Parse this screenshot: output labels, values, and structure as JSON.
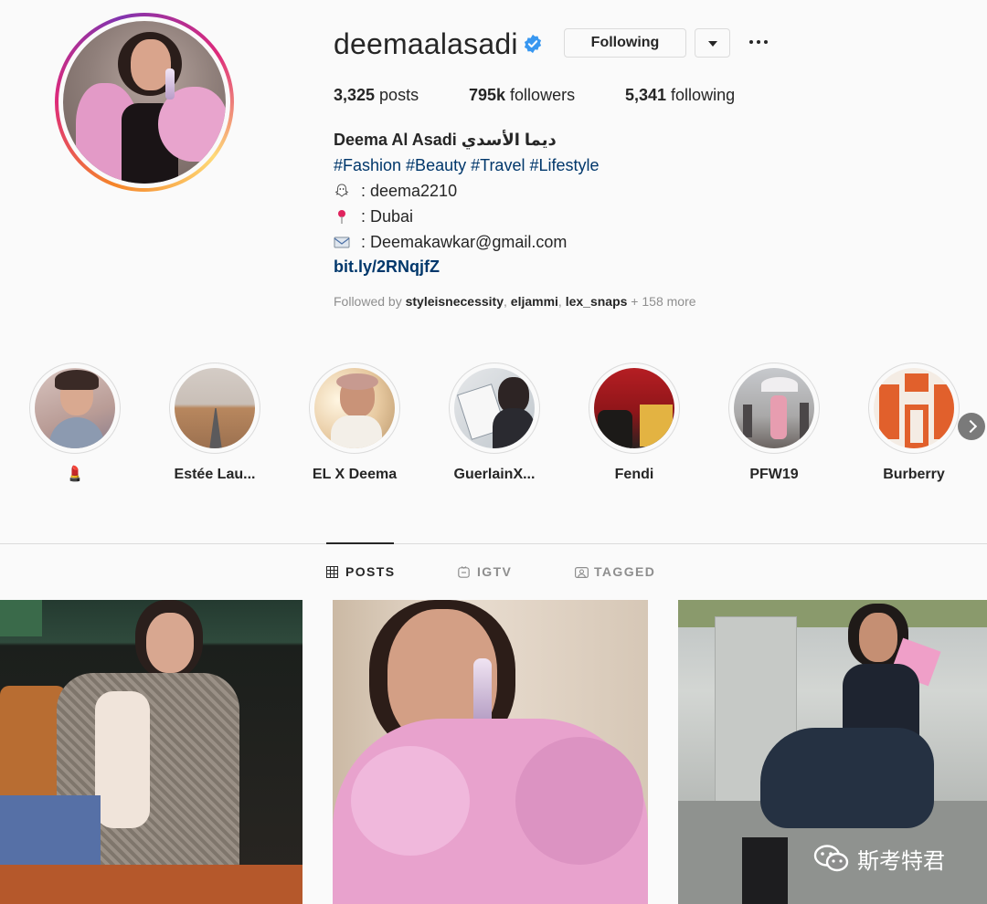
{
  "profile": {
    "username": "deemaalasadi",
    "following_button": "Following",
    "posts_count": "3,325",
    "posts_label": " posts",
    "followers_count": "795k",
    "followers_label": " followers",
    "following_count": "5,341",
    "following_label": " following",
    "full_name": "Deema Al Asadi ديما الأسدي",
    "hashtags": "#Fashion #Beauty #Travel #Lifestyle",
    "bio_lines": [
      {
        "icon": "snapchat-ghost-icon",
        "text": ": deema2210"
      },
      {
        "icon": "location-pin-icon",
        "text": ": Dubai"
      },
      {
        "icon": "email-envelope-icon",
        "text": ": Deemakawkar@gmail.com"
      }
    ],
    "link": "bit.ly/2RNqjfZ",
    "followed_by_prefix": "Followed by ",
    "followed_by_users": "styleisnecessity",
    "followed_by_sep1": ", ",
    "followed_by_user2": "eljammi",
    "followed_by_sep2": ", ",
    "followed_by_user3": "lex_snaps",
    "followed_by_more": " + 158 more"
  },
  "highlights": [
    {
      "label": "💄"
    },
    {
      "label": "Estée Lau..."
    },
    {
      "label": "EL X Deema"
    },
    {
      "label": "GuerlainX..."
    },
    {
      "label": "Fendi"
    },
    {
      "label": "PFW19"
    },
    {
      "label": "Burberry"
    }
  ],
  "tabs": [
    {
      "label": "POSTS",
      "icon": "grid-icon",
      "active": true
    },
    {
      "label": "IGTV",
      "icon": "igtv-icon",
      "active": false
    },
    {
      "label": "TAGGED",
      "icon": "tagged-icon",
      "active": false
    }
  ],
  "watermark": "斯考特君",
  "colors": {
    "link": "#00376b",
    "verified": "#3897f0",
    "text": "#262626",
    "muted": "#8e8e8e",
    "border": "#dbdbdb"
  }
}
